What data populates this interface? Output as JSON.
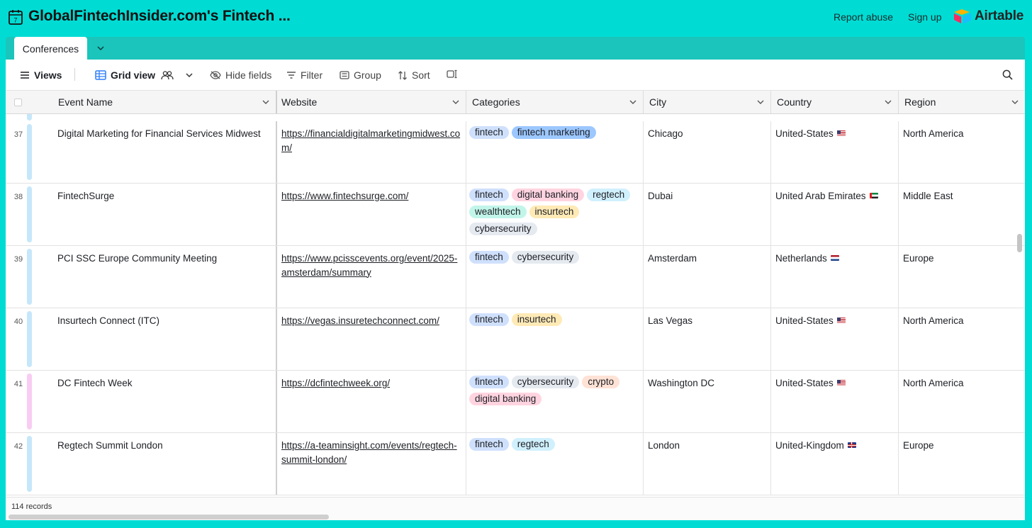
{
  "app": {
    "title": "GlobalFintechInsider.com's Fintech ...",
    "report_abuse": "Report abuse",
    "sign_up": "Sign up",
    "brand": "Airtable"
  },
  "tabs": {
    "active": "Conferences"
  },
  "toolbar": {
    "views": "Views",
    "grid_view": "Grid view",
    "hide_fields": "Hide fields",
    "filter": "Filter",
    "group": "Group",
    "sort": "Sort"
  },
  "columns": {
    "event_name": "Event Name",
    "website": "Website",
    "categories": "Categories",
    "city": "City",
    "country": "Country",
    "region": "Region"
  },
  "tag_colors": {
    "fintech": "#cfe0fc",
    "fintech marketing": "#9cc7ff",
    "digital banking": "#ffd4e0",
    "regtech": "#d0f0fd",
    "wealthtech": "#c2f5e9",
    "insurtech": "#ffeab6",
    "cybersecurity": "#e5e9f0",
    "crypto": "#fee2d5"
  },
  "rows": [
    {
      "num": "37",
      "bar_color": "#c5e7f9",
      "name": "Digital Marketing for Financial Services Midwest",
      "website": "https://financialdigitalmarketingmidwest.com/",
      "categories": [
        "fintech",
        "fintech marketing"
      ],
      "city": "Chicago",
      "country": "United-States",
      "flag": "us",
      "region": "North America"
    },
    {
      "num": "38",
      "bar_color": "#c5e7f9",
      "name": "FintechSurge",
      "website": "https://www.fintechsurge.com/",
      "categories": [
        "fintech",
        "digital banking",
        "regtech",
        "wealthtech",
        "insurtech",
        "cybersecurity"
      ],
      "city": "Dubai",
      "country": "United Arab Emirates",
      "flag": "ae",
      "region": "Middle East"
    },
    {
      "num": "39",
      "bar_color": "#c5e7f9",
      "name": "PCI SSC Europe Community Meeting",
      "website": "https://www.pcisscevents.org/event/2025-amsterdam/summary",
      "categories": [
        "fintech",
        "cybersecurity"
      ],
      "city": "Amsterdam",
      "country": "Netherlands",
      "flag": "nl",
      "region": "Europe"
    },
    {
      "num": "40",
      "bar_color": "#c5e7f9",
      "name": "Insurtech Connect (ITC)",
      "website": "https://vegas.insuretechconnect.com/",
      "categories": [
        "fintech",
        "insurtech"
      ],
      "city": "Las Vegas",
      "country": "United-States",
      "flag": "us",
      "region": "North America"
    },
    {
      "num": "41",
      "bar_color": "#f8cdf1",
      "name": "DC Fintech Week",
      "website": "https://dcfintechweek.org/",
      "categories": [
        "fintech",
        "cybersecurity",
        "crypto",
        "digital banking"
      ],
      "city": "Washington DC",
      "country": "United-States",
      "flag": "us",
      "region": "North America"
    },
    {
      "num": "42",
      "bar_color": "#c5e7f9",
      "name": "Regtech Summit London",
      "website": "https://a-teaminsight.com/events/regtech-summit-london/",
      "categories": [
        "fintech",
        "regtech"
      ],
      "city": "London",
      "country": "United-Kingdom",
      "flag": "gb",
      "region": "Europe"
    }
  ],
  "footer": {
    "record_count": "114 records"
  }
}
